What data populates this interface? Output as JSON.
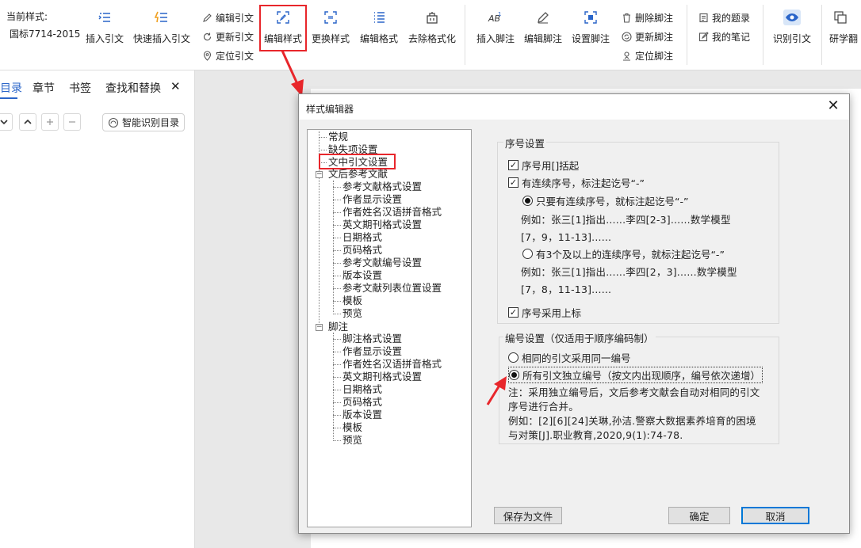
{
  "ribbon": {
    "current_style_label": "当前样式:",
    "current_style_value": "国标7714-2015",
    "insert_citation": "插入引文",
    "quick_insert_citation": "快速插入引文",
    "edit_citation": "编辑引文",
    "update_citation": "更新引文",
    "locate_citation": "定位引文",
    "edit_style": "编辑样式",
    "change_style": "更换样式",
    "edit_format": "编辑格式",
    "remove_formatting": "去除格式化",
    "insert_footnote": "插入脚注",
    "edit_footnote": "编辑脚注",
    "set_footnote": "设置脚注",
    "delete_footnote": "删除脚注",
    "update_footnote": "更新脚注",
    "locate_footnote": "定位脚注",
    "my_topics": "我的题录",
    "my_notes": "我的笔记",
    "recognize_citation": "识别引文",
    "research": "研学翻"
  },
  "nav": {
    "tabs": [
      "目录",
      "章节",
      "书签",
      "查找和替换"
    ],
    "close": "✕",
    "smart_toc": "智能识别目录"
  },
  "dialog": {
    "title": "样式编辑器",
    "close": "✕",
    "tree": {
      "general": "常规",
      "missing_items": "缺失项设置",
      "in_text_citation": "文中引文设置",
      "references": "文后参考文献",
      "ref_children": [
        "参考文献格式设置",
        "作者显示设置",
        "作者姓名汉语拼音格式",
        "英文期刊格式设置",
        "日期格式",
        "页码格式",
        "参考文献编号设置",
        "版本设置",
        "参考文献列表位置设置",
        "模板",
        "预览"
      ],
      "footnote": "脚注",
      "footnote_children": [
        "脚注格式设置",
        "作者显示设置",
        "作者姓名汉语拼音格式",
        "英文期刊格式设置",
        "日期格式",
        "页码格式",
        "版本设置",
        "模板",
        "预览"
      ]
    },
    "seq": {
      "title": "序号设置",
      "brackets_label": "序号用[]括起",
      "brackets_checked": true,
      "consecutive_label": "有连续序号，标注起讫号“-”",
      "consecutive_checked": true,
      "opt1_label": "只要有连续序号，就标注起讫号“-”",
      "opt1_selected": true,
      "opt1_example_1": "例如：张三[1]指出......李四[2-3]......数学模型",
      "opt1_example_2": "[7，9，11-13]......",
      "opt2_label": "有3个及以上的连续序号，就标注起讫号“-”",
      "opt2_selected": false,
      "opt2_example_1": "例如：张三[1]指出......李四[2，3]......数学模型",
      "opt2_example_2": "[7，8，11-13]......",
      "superscript_label": "序号采用上标",
      "superscript_checked": true
    },
    "numbering": {
      "title": "编号设置（仅适用于顺序编码制）",
      "same_label": "相同的引文采用同一编号",
      "same_selected": false,
      "independent_label": "所有引文独立编号（按文内出现顺序，编号依次递增）",
      "independent_selected": true,
      "note_1": "注：采用独立编号后，文后参考文献会自动对相同的引文",
      "note_2": "序号进行合并。",
      "example_1": "例如：[2][6][24]关琳,孙洁.警察大数据素养培育的困境",
      "example_2": "与对策[J].职业教育,2020,9(1):74-78."
    },
    "buttons": {
      "save_file": "保存为文件",
      "ok": "确定",
      "cancel": "取消"
    }
  },
  "colors": {
    "accent_blue": "#2a65c9",
    "highlight_red": "#e8262b"
  }
}
